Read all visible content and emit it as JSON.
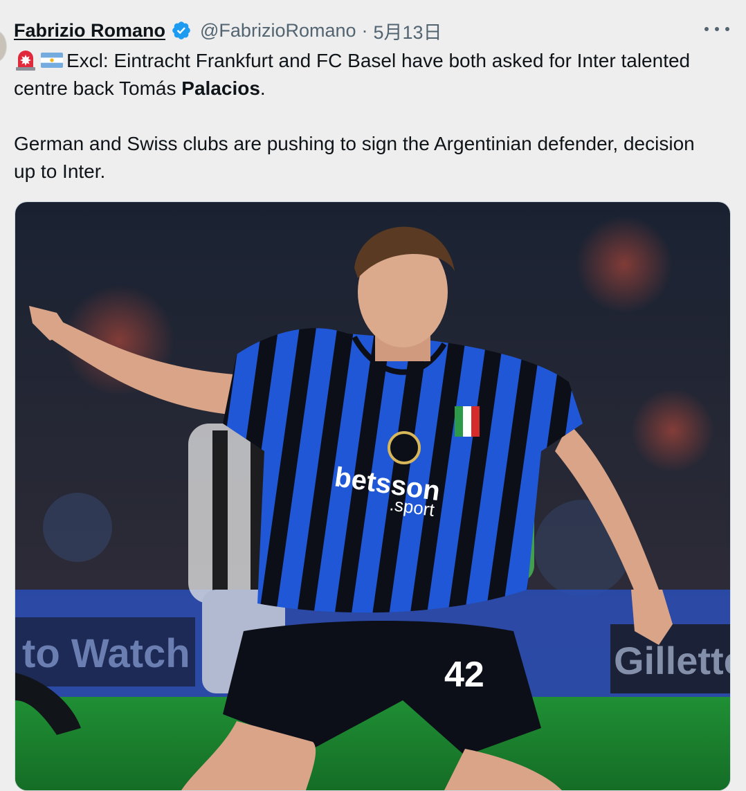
{
  "tweet": {
    "author_name": "Fabrizio Romano",
    "handle": "@FabrizioRomano",
    "separator": "·",
    "timestamp": "5月13日",
    "text_line1_prefix": "Excl: Eintracht Frankfurt and FC Basel have both asked for Inter talented centre back Tomás ",
    "text_line1_bold": "Palacios",
    "text_line1_suffix": ".",
    "text_paragraph2": "German and Swiss clubs are pushing to sign the Argentinian defender, decision up to Inter.",
    "emojis": [
      "siren-emoji",
      "argentina-flag-emoji"
    ]
  },
  "media": {
    "sponsor_main": "betsson",
    "sponsor_sub": ".sport",
    "shirt_number": "42",
    "board_left": "to Watch",
    "board_right": "Gillette",
    "colors": {
      "kit_blue": "#1f57d6",
      "kit_black": "#0d0f18",
      "pitch_green": "#1f8f34",
      "verified_blue": "#1d9bf0"
    }
  }
}
